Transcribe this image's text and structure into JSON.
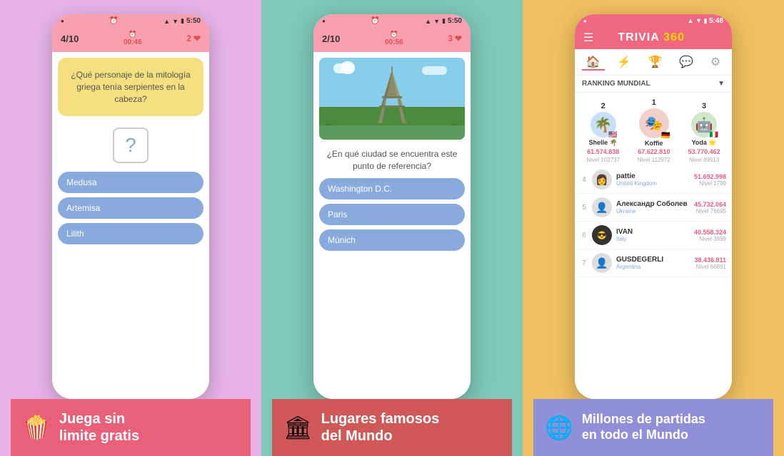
{
  "panel1": {
    "background": "#e8b4e8",
    "phone": {
      "statusbar": {
        "time": "5:50",
        "alarm": "⏰",
        "signal": "▲▲▲",
        "wifi": "wifi",
        "battery": "🔋"
      },
      "quizbar": {
        "progress": "4/10",
        "timer_label": "00:46",
        "lives": "2",
        "heart": "❤"
      },
      "question": "¿Qué personaje de la mitología griega tenía serpientes en la cabeza?",
      "placeholder": "?",
      "answers": [
        "Medusa",
        "Artemisa",
        "Lilith"
      ]
    },
    "banner": {
      "icon": "🍿",
      "line1": "Juega sin",
      "line2": "limite gratis"
    }
  },
  "panel2": {
    "background": "#7ec8b8",
    "phone": {
      "statusbar": {
        "time": "5:50",
        "alarm": "⏰"
      },
      "quizbar": {
        "progress": "2/10",
        "timer_label": "00:56",
        "lives": "3",
        "heart": "❤"
      },
      "question_text": "¿En qué ciudad se encuentra este punto de referencia?",
      "answers": [
        "Washington D.C.",
        "Paris",
        "Múnich"
      ]
    },
    "banner": {
      "icon": "🏛",
      "line1": "Lugares famosos",
      "line2": "del Mundo"
    }
  },
  "panel3": {
    "background": "#f0c060",
    "phone": {
      "statusbar": {
        "time": "5:48"
      },
      "title": "TRIVIA",
      "title_num": "360",
      "ranking_label": "RANKING MUNDIAL",
      "nav": [
        "🏠",
        "⚡",
        "🏆",
        "💬",
        "⚙"
      ],
      "podium": [
        {
          "rank": "2",
          "name": "Shelle 🌴",
          "score": "61.574.838",
          "level": "Nivel 102737",
          "flag": "🇺🇸",
          "emoji": "🌴"
        },
        {
          "rank": "1",
          "name": "Koffie",
          "score": "67.622.810",
          "level": "Nivel 112972",
          "flag": "🇩🇪",
          "emoji": "🎭"
        },
        {
          "rank": "3",
          "name": "Yoda 🌟",
          "score": "53.770.462",
          "level": "Nivel 89913",
          "flag": "🇮🇹",
          "emoji": "🤖"
        }
      ],
      "ranking": [
        {
          "rank": "4",
          "name": "pattie",
          "country": "United Kingdom",
          "score": "51.692.998",
          "level": "Nivel 1799",
          "emoji": "👩"
        },
        {
          "rank": "5",
          "name": "Александр Соболев",
          "country": "Ukraine",
          "score": "45.732.064",
          "level": "Nivel 76695",
          "emoji": "👤"
        },
        {
          "rank": "6",
          "name": "IVAN",
          "country": "Italy",
          "score": "40.558.324",
          "level": "Nivel 3999",
          "emoji": "😎"
        },
        {
          "rank": "7",
          "name": "GUSDEGERLI",
          "country": "Argentina",
          "score": "38.436.811",
          "level": "Nivel 66891",
          "emoji": "👤"
        }
      ]
    },
    "banner": {
      "icon": "🌐",
      "line1": "Millones de partidas",
      "line2": "en todo el Mundo"
    }
  }
}
